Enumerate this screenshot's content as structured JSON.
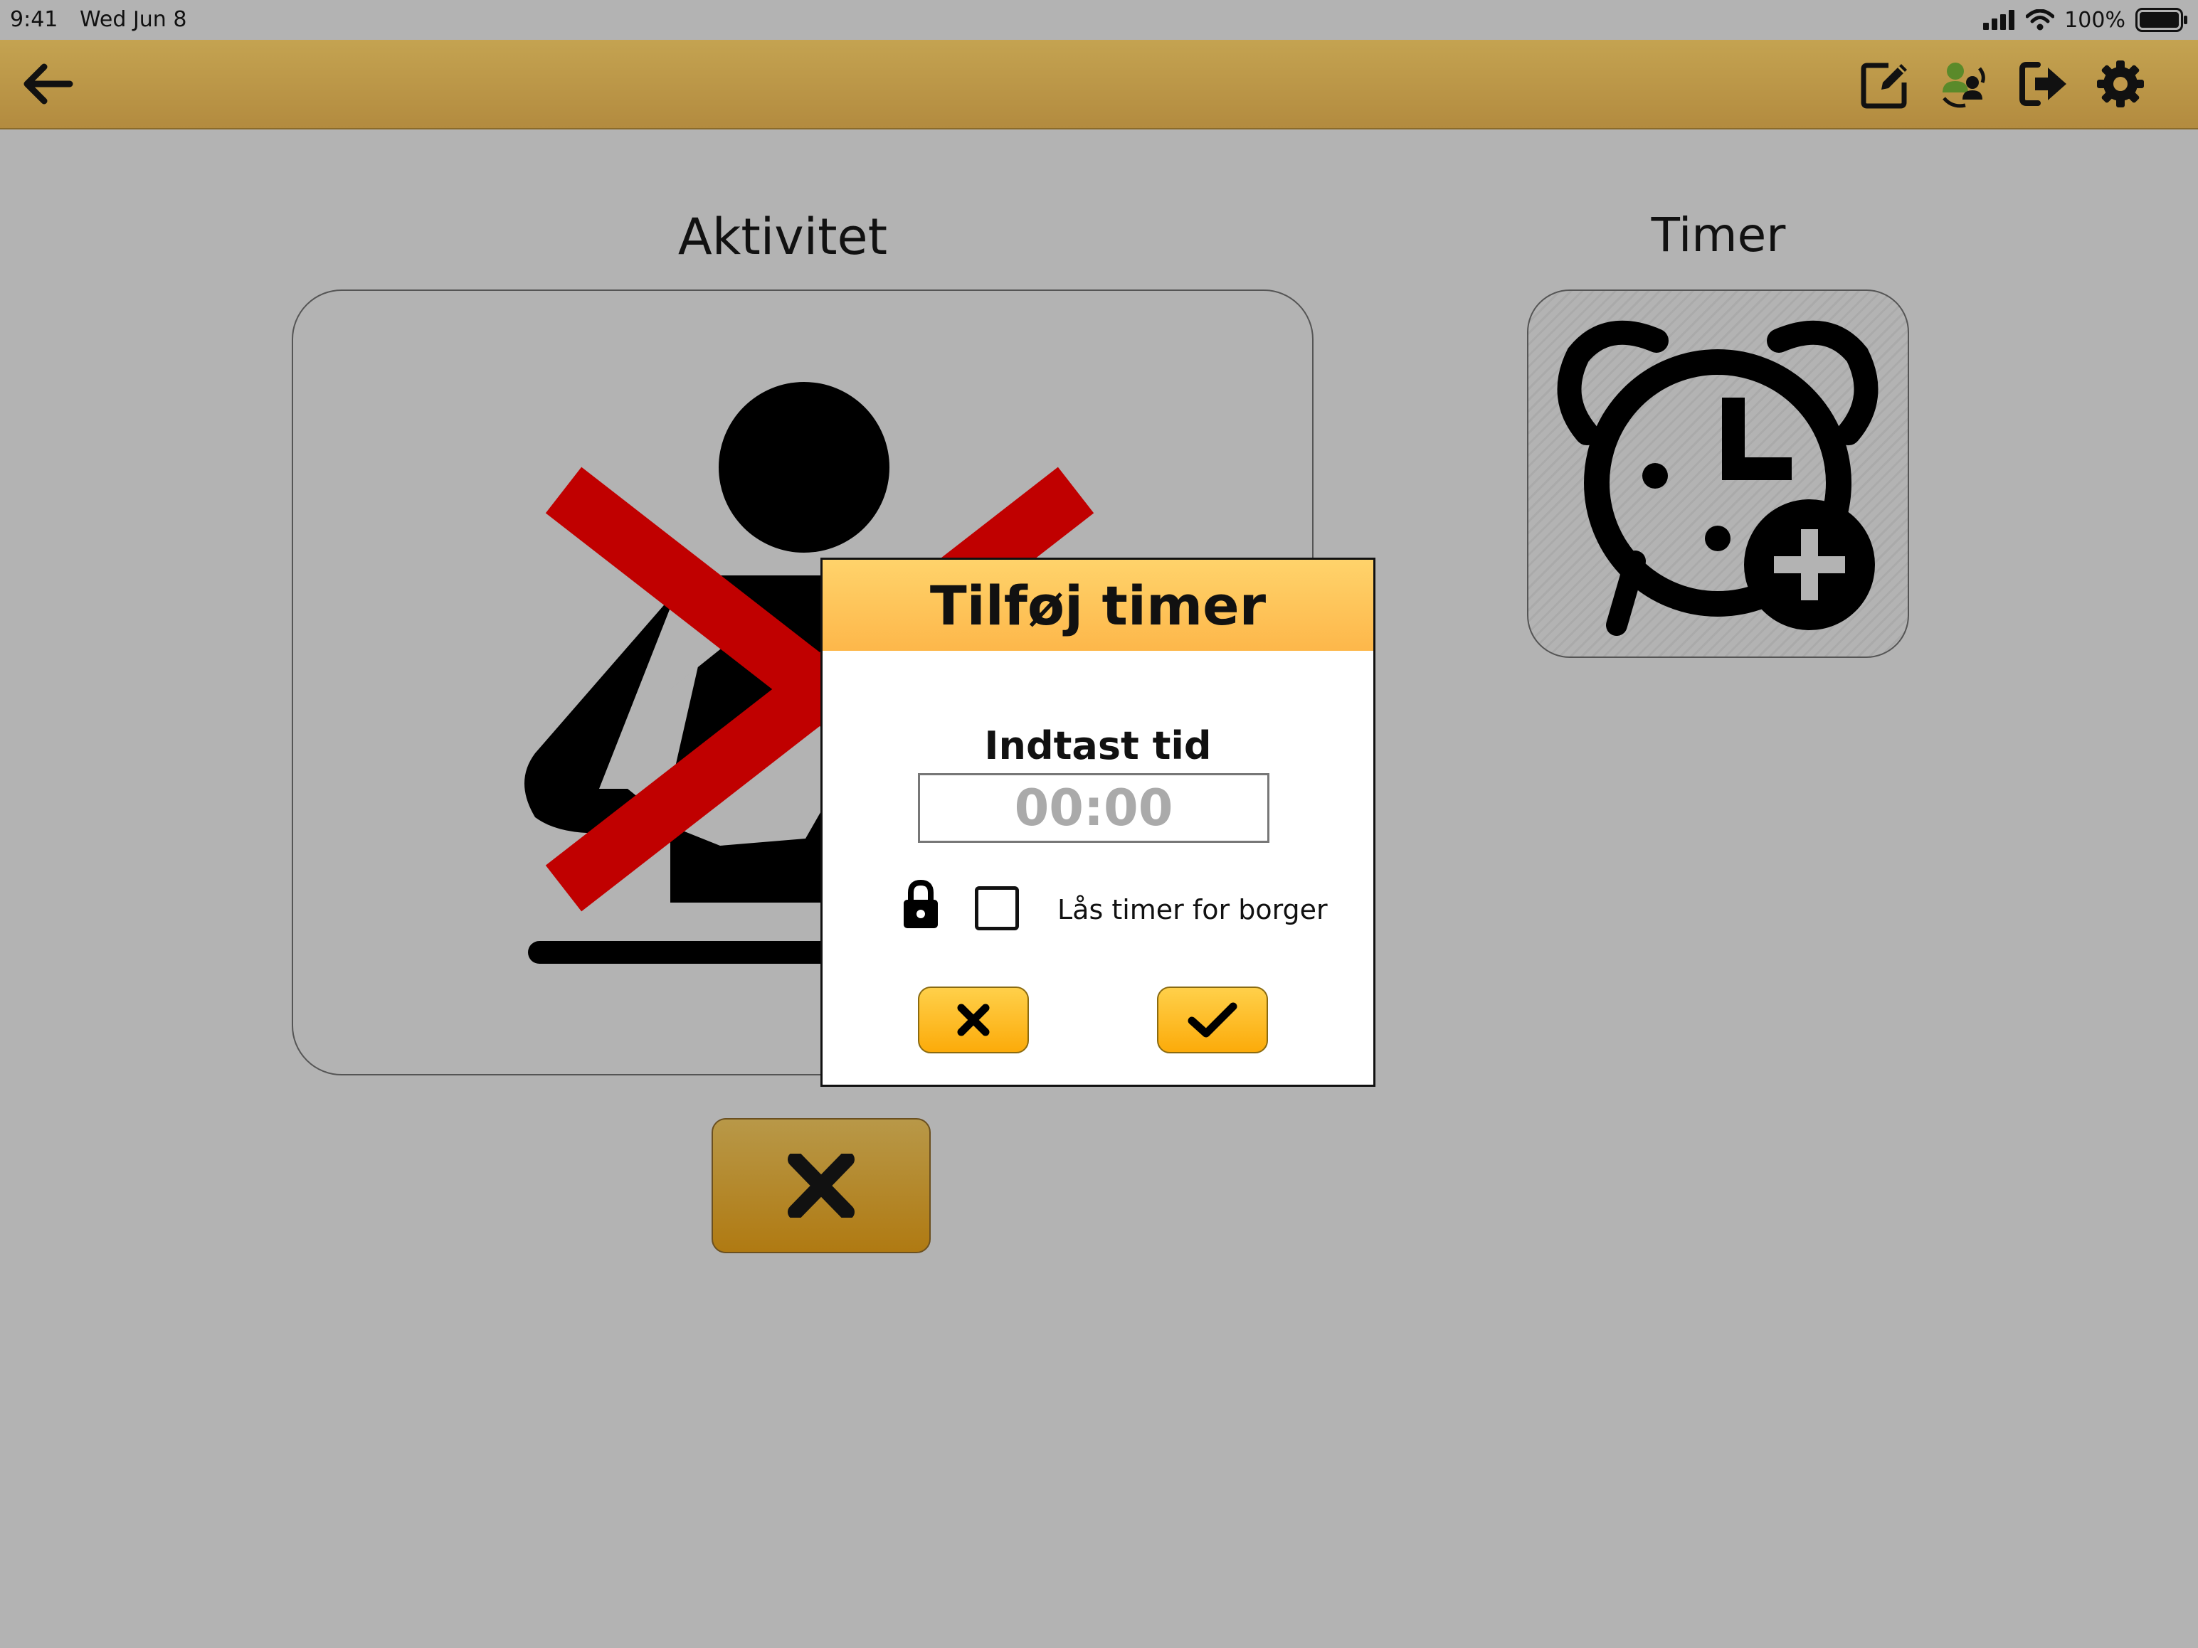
{
  "status_bar": {
    "time": "9:41",
    "date": "Wed Jun 8",
    "battery_percent": "100%",
    "icons": [
      "cellular-signal-icon",
      "wifi-icon",
      "battery-icon"
    ]
  },
  "navbar": {
    "background_color": "#b8923f",
    "buttons": [
      {
        "name": "back-button",
        "icon": "arrow-left-icon"
      },
      {
        "name": "edit-button",
        "icon": "edit-pencil-icon"
      },
      {
        "name": "switch-citizen-button",
        "icon": "user-switch-icon"
      },
      {
        "name": "logout-button",
        "icon": "logout-icon"
      },
      {
        "name": "settings-button",
        "icon": "gear-icon"
      }
    ]
  },
  "activity": {
    "title": "Aktivitet",
    "pictogram_icon": "person-at-desk-icon",
    "cancelled_overlay_color": "#c00000",
    "cancel_button_icon": "close-icon"
  },
  "timer": {
    "title": "Timer",
    "icon": "alarm-clock-add-icon"
  },
  "dialog": {
    "title": "Tilføj timer",
    "label": "Indtast tid",
    "input_value": "",
    "input_placeholder": "00:00",
    "lock_label": "Lås timer for borger",
    "lock_checked": false,
    "cancel_icon": "close-icon",
    "confirm_icon": "checkmark-icon",
    "header_color": "#fec55a",
    "button_color": "#fdbd2a"
  }
}
